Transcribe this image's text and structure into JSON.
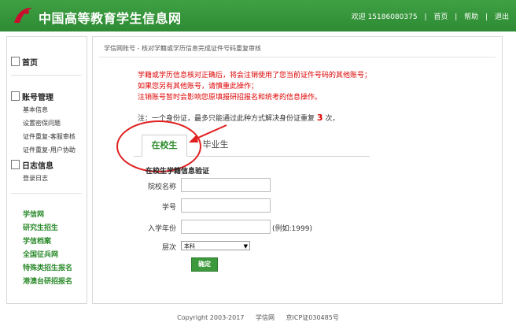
{
  "header": {
    "site_title": "中国高等教育学生信息网",
    "welcome": "欢迎 15186080375",
    "nav": [
      "首页",
      "帮助",
      "退出"
    ],
    "brand_color": "#33963a"
  },
  "sidebar": {
    "home": "首页",
    "account": {
      "title": "账号管理",
      "items": [
        "基本信息",
        "设置密保问题",
        "证件重复-客服审核",
        "证件重复-用户协助"
      ]
    },
    "log": {
      "title": "日志信息",
      "items": [
        "登录日志"
      ]
    },
    "links": [
      "学信网",
      "研究生招生",
      "学信档案",
      "全国征兵网",
      "特殊类招生报名",
      "港澳台研招报名"
    ]
  },
  "main": {
    "breadcrumb": "学信网账号 - 核对学籍或学历信息完成证件号码重复审核",
    "warnings": [
      "学籍或学历信息核对正确后，将会注销使用了您当前证件号码的其他账号；",
      "如果您另有其他账号，请慎重此操作；",
      "注销账号暂时会影响您原填报研招报名和统考的信息操作。"
    ],
    "limit_prefix": "注：一个身份证，最多只能通过此种方式解决身份证重复",
    "limit_count": "3",
    "limit_suffix": "次，",
    "tabs": [
      "在校生",
      "毕业生"
    ],
    "form": {
      "title": "在校生学籍信息验证",
      "school_label": "院校名称",
      "student_id_label": "学号",
      "enroll_year_label": "入学年份",
      "enroll_year_hint": "(例如:1999)",
      "level_label": "层次",
      "level_value": "本科",
      "submit": "确定"
    }
  },
  "footer": {
    "copyright": "Copyright 2003-2017",
    "site": "学信网",
    "icp": "京ICP证030485号"
  }
}
